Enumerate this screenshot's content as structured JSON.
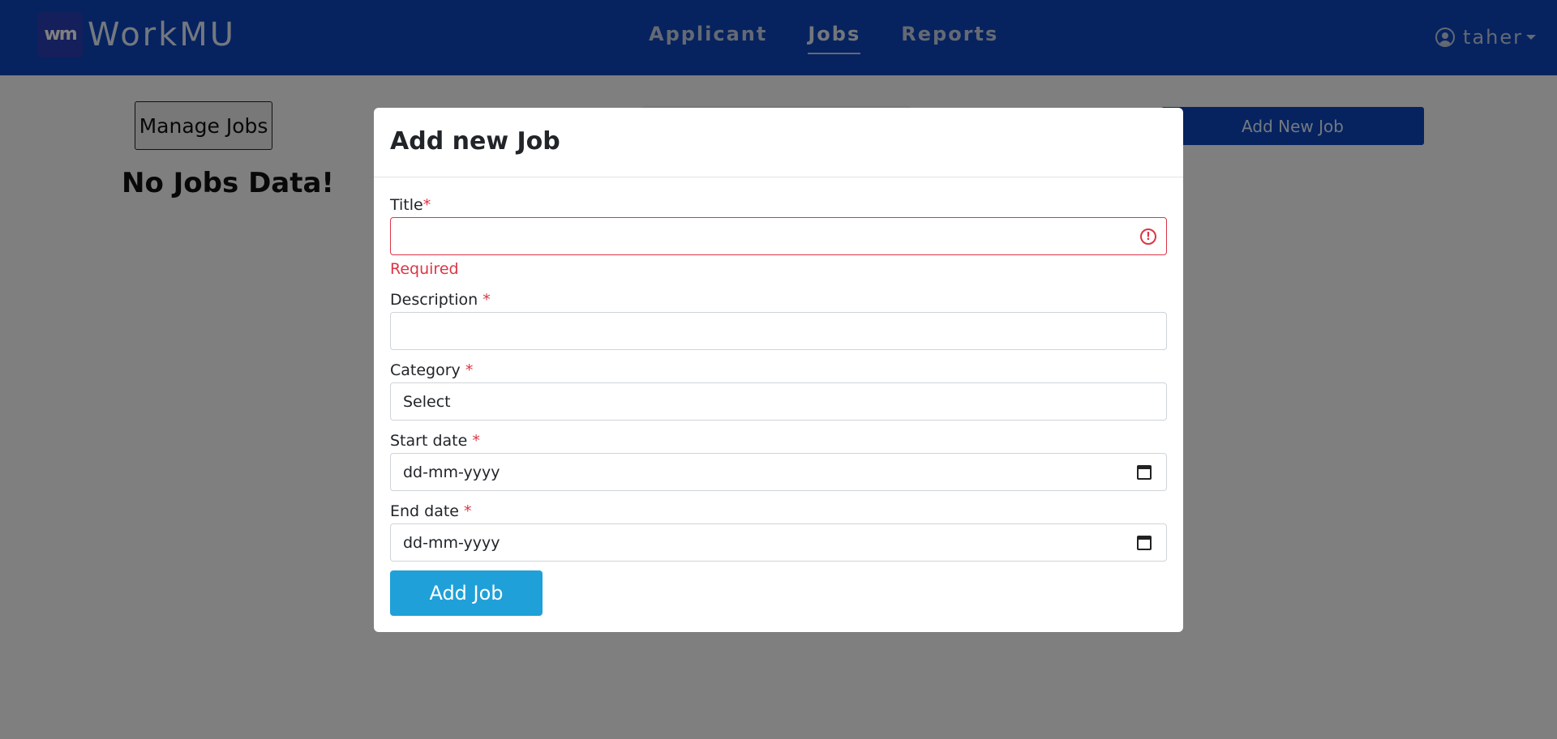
{
  "app": {
    "logo_mark": "wm",
    "name": "WorkMU"
  },
  "nav": {
    "links": [
      "Applicant",
      "Jobs",
      "Reports"
    ],
    "active": "Jobs"
  },
  "user": {
    "name": "taher"
  },
  "page": {
    "manage_label": "Manage Jobs",
    "empty_message": "No Jobs Data!",
    "add_new_label": "Add New Job"
  },
  "modal": {
    "title": "Add new Job",
    "fields": {
      "title": {
        "label": "Title",
        "required_mark": "*",
        "value": "",
        "error": "Required"
      },
      "description": {
        "label": "Description ",
        "required_mark": "*",
        "value": ""
      },
      "category": {
        "label": "Category ",
        "required_mark": "*",
        "value": "Select"
      },
      "start_date": {
        "label": "Start date ",
        "required_mark": "*",
        "placeholder": "dd-mm-yyyy"
      },
      "end_date": {
        "label": "End date ",
        "required_mark": "*",
        "placeholder": "dd-mm-yyyy"
      }
    },
    "submit_label": "Add Job"
  },
  "colors": {
    "navbar": "#0d47c0",
    "primary_button": "#1fa0d8",
    "error": "#dc3545"
  }
}
